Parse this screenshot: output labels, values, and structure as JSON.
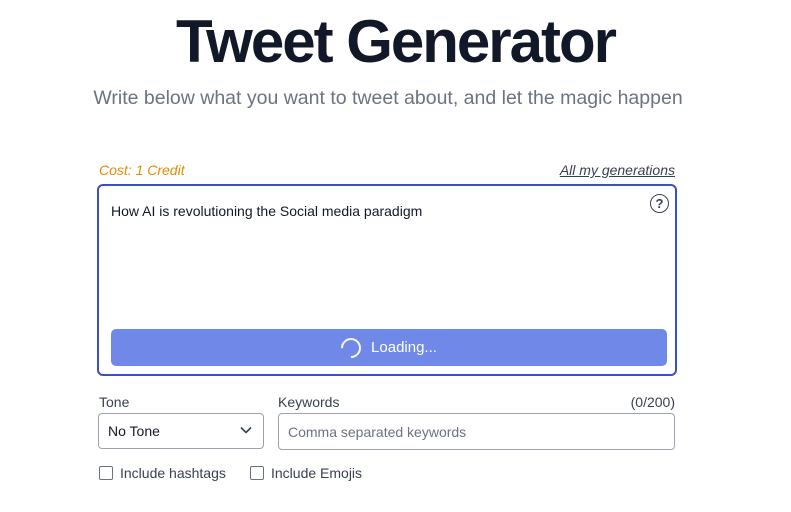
{
  "header": {
    "title": "Tweet Generator",
    "subtitle": "Write below what you want to tweet about, and let the magic happen"
  },
  "form": {
    "cost_label": "Cost: 1 Credit",
    "generations_link": "All my generations",
    "prompt_value": "How AI is revolutioning the Social media paradigm",
    "help_icon": "question-circle-icon",
    "loading_label": "Loading...",
    "tone": {
      "label": "Tone",
      "selected": "No Tone"
    },
    "keywords": {
      "label": "Keywords",
      "count": "(0/200)",
      "placeholder": "Comma separated keywords",
      "value": ""
    },
    "options": {
      "hashtags_label": "Include hashtags",
      "hashtags_checked": false,
      "emojis_label": "Include Emojis",
      "emojis_checked": false
    }
  },
  "colors": {
    "accent_border": "#3b4fc4",
    "button_bg": "#7089e8",
    "cost_text": "#e58a00",
    "title_text": "#111827"
  }
}
